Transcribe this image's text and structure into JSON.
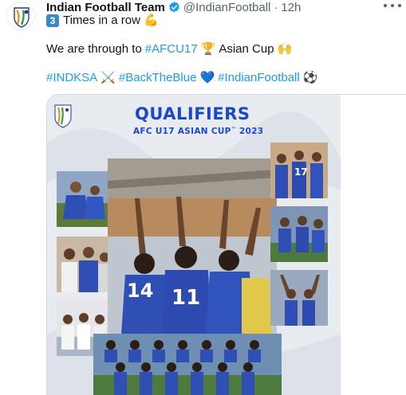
{
  "tweet": {
    "display_name": "Indian Football Team",
    "handle": "@IndianFootball",
    "separator": "·",
    "time": "12h",
    "line1": {
      "badge": "3",
      "text": "Times in a row",
      "emoji": "💪"
    },
    "line2": {
      "prefix": "We are through to",
      "hashtag": "#AFCU17",
      "emoji": "🏆",
      "suffix": "Asian Cup",
      "emoji2": "🙌"
    },
    "line3": {
      "tag1": "#INDKSA",
      "emoji1": "⚔️",
      "tag2": "#BackTheBlue",
      "emoji2": "💙",
      "tag3": "#IndianFootball",
      "emoji3": "⚽"
    },
    "icons": {
      "verified": "verified-badge-icon",
      "more": "more-options-icon"
    }
  },
  "media": {
    "title": "QUALIFIERS",
    "subtitle": "AFC U17 ASIAN CUP",
    "subtitle_tm": "™",
    "subtitle_year": "2023",
    "jersey_numbers": [
      "14",
      "11",
      "17"
    ],
    "colors": {
      "accent": "#1d9bf0",
      "brand_blue": "#1b48c8",
      "kit_blue": "#2f4fb4"
    }
  }
}
